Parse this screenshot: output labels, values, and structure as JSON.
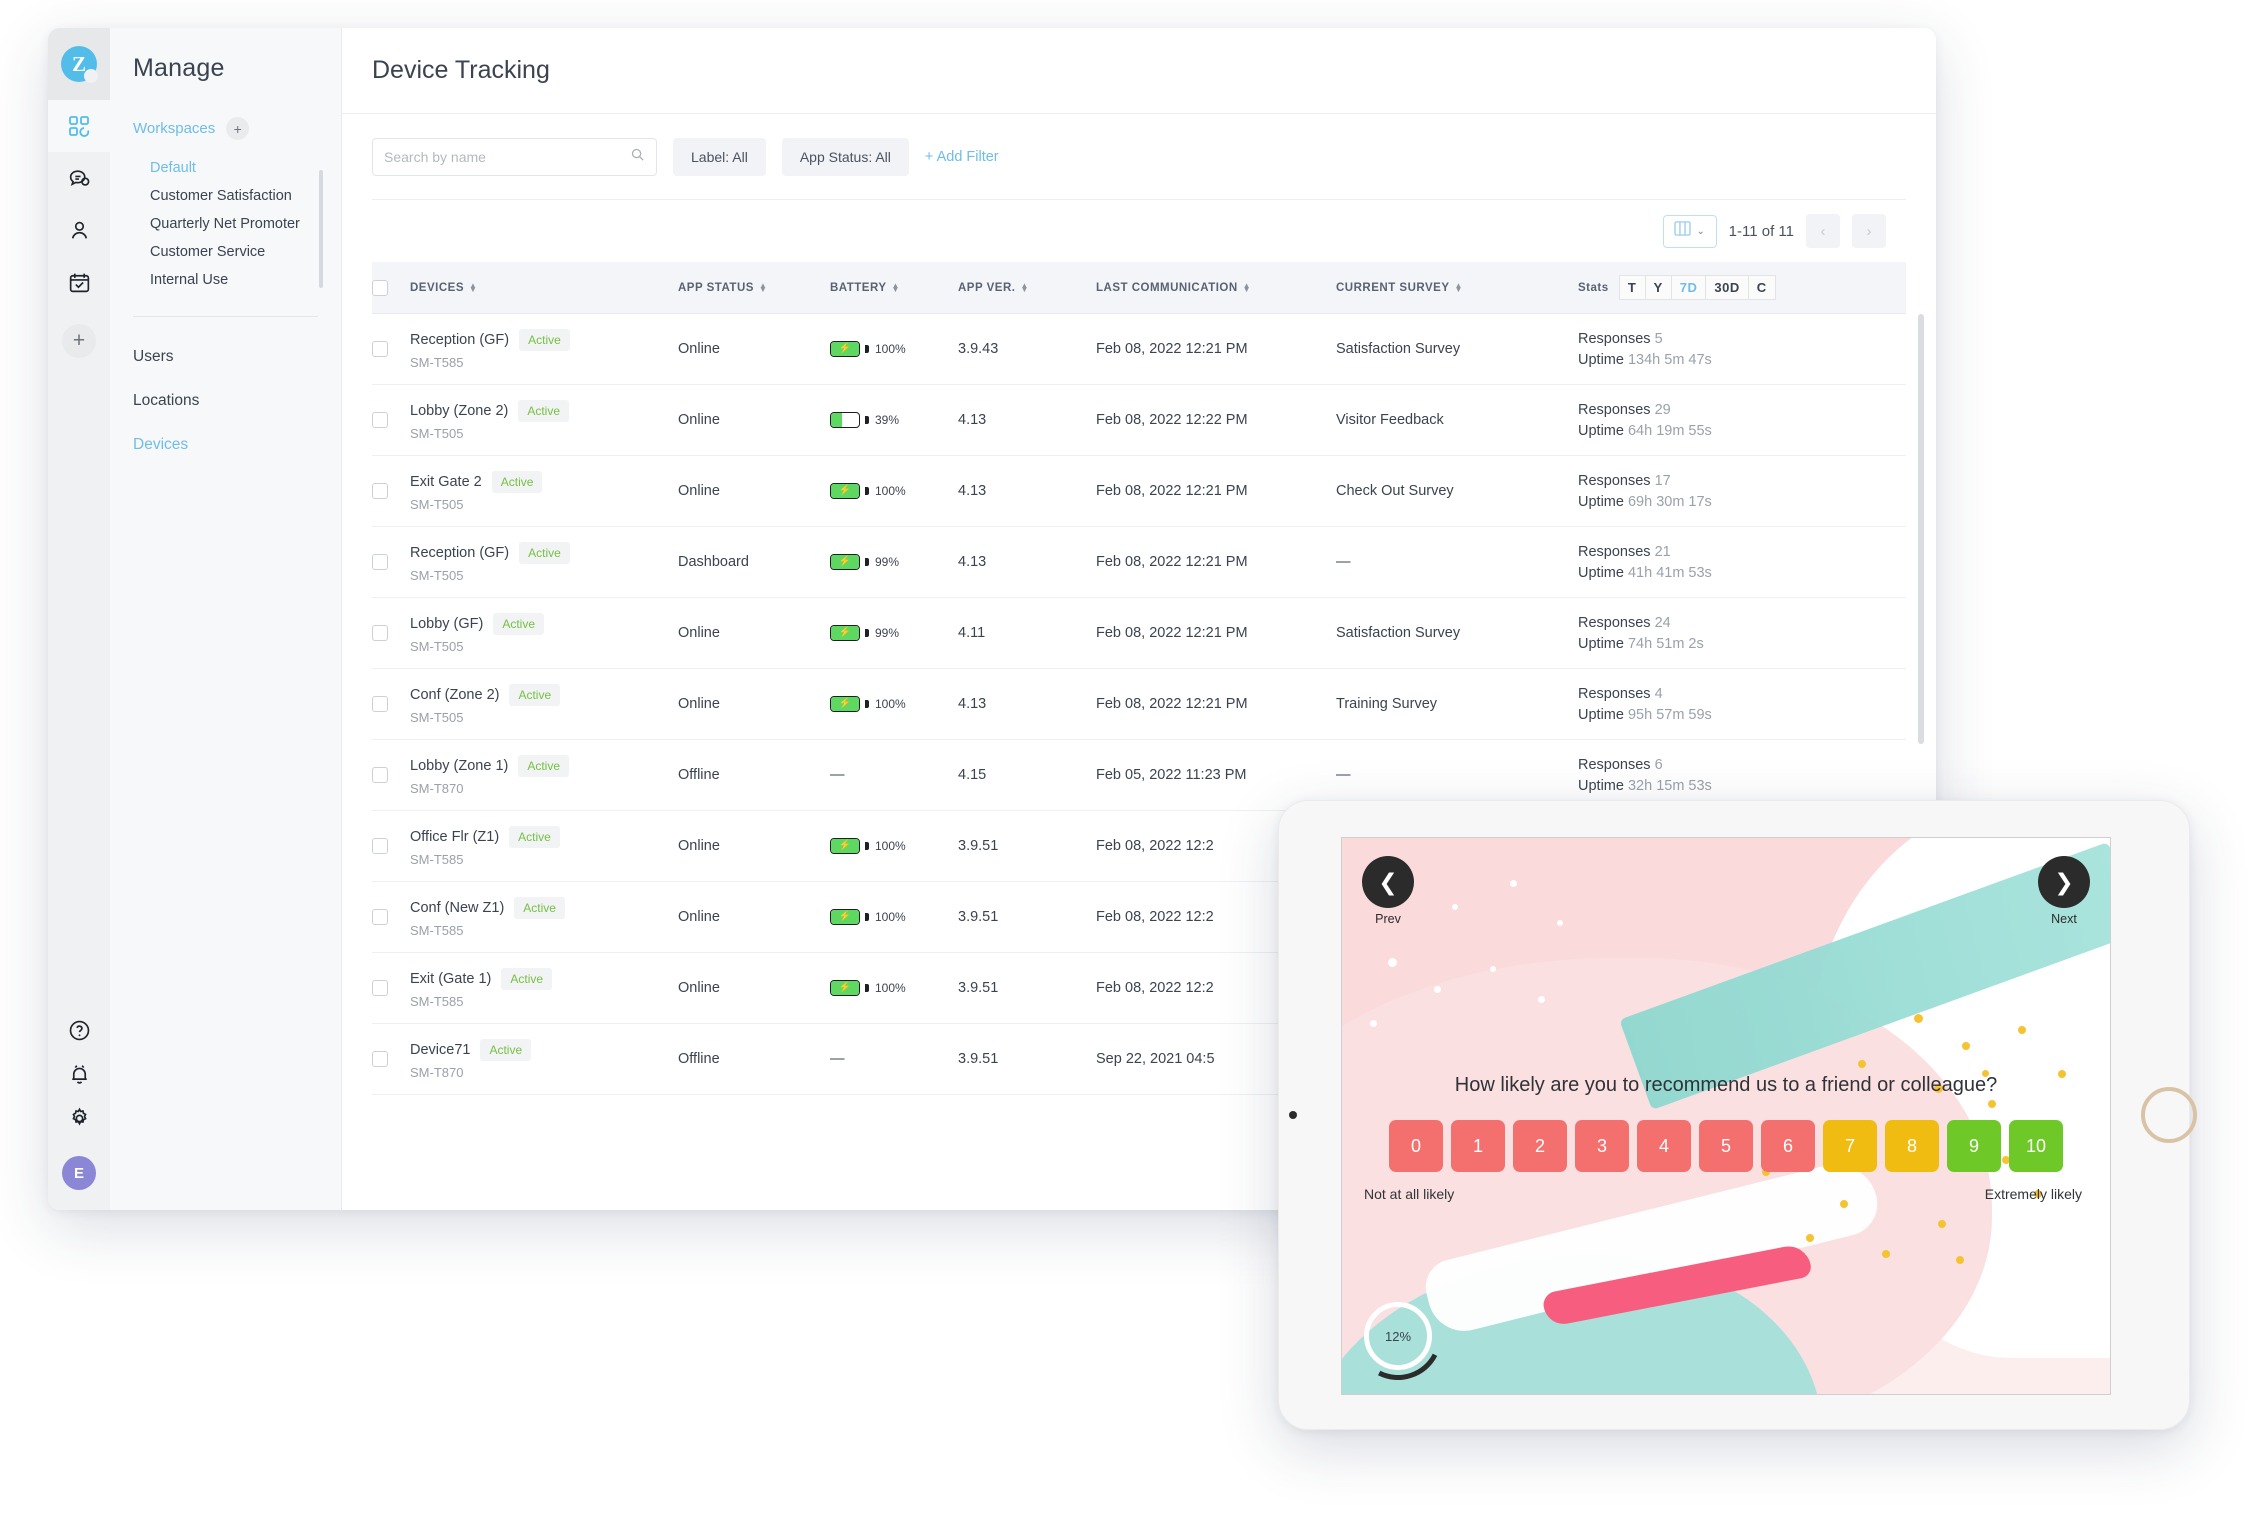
{
  "app": {
    "logo_letter": "Z",
    "nav_title": "Manage",
    "rail_icons": [
      {
        "name": "workspace-grid-icon",
        "glyph": "grid"
      },
      {
        "name": "feedback-chat-icon",
        "glyph": "chat"
      },
      {
        "name": "contacts-person-icon",
        "glyph": "person"
      },
      {
        "name": "tasks-calendar-icon",
        "glyph": "calendar"
      }
    ],
    "rail_add_label": "+",
    "rail_bottom_icons": [
      {
        "name": "help-icon",
        "glyph": "question"
      },
      {
        "name": "notifications-bell-icon",
        "glyph": "bell"
      },
      {
        "name": "settings-gear-icon",
        "glyph": "gear"
      }
    ],
    "avatar_letter": "E"
  },
  "sidebar": {
    "workspaces_label": "Workspaces",
    "workspaces_add": "+",
    "workspaces": [
      {
        "label": "Default",
        "selected": true
      },
      {
        "label": "Customer Satisfaction",
        "selected": false
      },
      {
        "label": "Quarterly Net Promoter",
        "selected": false
      },
      {
        "label": "Customer Service",
        "selected": false
      },
      {
        "label": "Internal Use",
        "selected": false
      }
    ],
    "links": [
      {
        "label": "Users",
        "selected": false
      },
      {
        "label": "Locations",
        "selected": false
      },
      {
        "label": "Devices",
        "selected": true
      }
    ]
  },
  "page": {
    "title": "Device Tracking"
  },
  "filters": {
    "search_placeholder": "Search by name",
    "search_value": "",
    "search_icon": "search-icon",
    "chips": [
      {
        "label": "Label: All"
      },
      {
        "label": "App Status: All"
      }
    ],
    "add_filter": "+ Add Filter"
  },
  "toolbar": {
    "columns_icon": "columns-icon",
    "columns_chevron": "⌄",
    "range": "1-11 of 11",
    "prev_glyph": "‹",
    "next_glyph": "›"
  },
  "table": {
    "columns": [
      {
        "label": "DEVICES",
        "sortable": true
      },
      {
        "label": "APP STATUS",
        "sortable": true
      },
      {
        "label": "BATTERY",
        "sortable": true
      },
      {
        "label": "APP VER.",
        "sortable": true
      },
      {
        "label": "LAST COMMUNICATION",
        "sortable": true
      },
      {
        "label": "CURRENT SURVEY",
        "sortable": true
      }
    ],
    "stats_label": "Stats",
    "stats_segments": [
      {
        "label": "T",
        "active": false
      },
      {
        "label": "Y",
        "active": false
      },
      {
        "label": "7D",
        "active": true
      },
      {
        "label": "30D",
        "active": false
      },
      {
        "label": "C",
        "active": false
      }
    ],
    "responses_label": "Responses",
    "uptime_label": "Uptime",
    "rows": [
      {
        "name": "Reception (GF)",
        "badge": "Active",
        "model": "SM-T585",
        "app_status": "Online",
        "battery": "100%",
        "battery_pct": 100,
        "charging": true,
        "app_ver": "3.9.43",
        "last_comm": "Feb 08, 2022 12:21 PM",
        "current_survey": "Satisfaction Survey",
        "responses": "5",
        "uptime": "134h 5m 47s"
      },
      {
        "name": "Lobby (Zone 2)",
        "badge": "Active",
        "model": "SM-T505",
        "app_status": "Online",
        "battery": "39%",
        "battery_pct": 39,
        "charging": false,
        "app_ver": "4.13",
        "last_comm": "Feb 08, 2022 12:22 PM",
        "current_survey": "Visitor Feedback",
        "responses": "29",
        "uptime": "64h 19m 55s"
      },
      {
        "name": "Exit Gate 2",
        "badge": "Active",
        "model": "SM-T505",
        "app_status": "Online",
        "battery": "100%",
        "battery_pct": 100,
        "charging": true,
        "app_ver": "4.13",
        "last_comm": "Feb 08, 2022 12:21 PM",
        "current_survey": "Check Out Survey",
        "responses": "17",
        "uptime": "69h 30m 17s"
      },
      {
        "name": "Reception (GF)",
        "badge": "Active",
        "model": "SM-T505",
        "app_status": "Dashboard",
        "battery": "99%",
        "battery_pct": 99,
        "charging": true,
        "app_ver": "4.13",
        "last_comm": "Feb 08, 2022 12:21 PM",
        "current_survey": "—",
        "responses": "21",
        "uptime": "41h 41m 53s"
      },
      {
        "name": "Lobby (GF)",
        "badge": "Active",
        "model": "SM-T505",
        "app_status": "Online",
        "battery": "99%",
        "battery_pct": 99,
        "charging": true,
        "app_ver": "4.11",
        "last_comm": "Feb 08, 2022 12:21 PM",
        "current_survey": "Satisfaction Survey",
        "responses": "24",
        "uptime": "74h 51m 2s"
      },
      {
        "name": "Conf (Zone 2)",
        "badge": "Active",
        "model": "SM-T505",
        "app_status": "Online",
        "battery": "100%",
        "battery_pct": 100,
        "charging": true,
        "app_ver": "4.13",
        "last_comm": "Feb 08, 2022 12:21 PM",
        "current_survey": "Training Survey",
        "responses": "4",
        "uptime": "95h 57m 59s"
      },
      {
        "name": "Lobby (Zone 1)",
        "badge": "Active",
        "model": "SM-T870",
        "app_status": "Offline",
        "battery": "—",
        "battery_pct": null,
        "charging": false,
        "app_ver": "4.15",
        "last_comm": "Feb 05, 2022 11:23 PM",
        "current_survey": "—",
        "responses": "6",
        "uptime": "32h 15m 53s"
      },
      {
        "name": "Office Flr (Z1)",
        "badge": "Active",
        "model": "SM-T585",
        "app_status": "Online",
        "battery": "100%",
        "battery_pct": 100,
        "charging": true,
        "app_ver": "3.9.51",
        "last_comm": "Feb 08, 2022 12:2",
        "current_survey": "",
        "responses": "",
        "uptime": ""
      },
      {
        "name": "Conf (New Z1)",
        "badge": "Active",
        "model": "SM-T585",
        "app_status": "Online",
        "battery": "100%",
        "battery_pct": 100,
        "charging": true,
        "app_ver": "3.9.51",
        "last_comm": "Feb 08, 2022 12:2",
        "current_survey": "",
        "responses": "",
        "uptime": ""
      },
      {
        "name": "Exit (Gate 1)",
        "badge": "Active",
        "model": "SM-T585",
        "app_status": "Online",
        "battery": "100%",
        "battery_pct": 100,
        "charging": true,
        "app_ver": "3.9.51",
        "last_comm": "Feb 08, 2022 12:2",
        "current_survey": "",
        "responses": "",
        "uptime": ""
      },
      {
        "name": "Device71",
        "badge": "Active",
        "model": "SM-T870",
        "app_status": "Offline",
        "battery": "—",
        "battery_pct": null,
        "charging": false,
        "app_ver": "3.9.51",
        "last_comm": "Sep 22, 2021 04:5",
        "current_survey": "",
        "responses": "",
        "uptime": ""
      }
    ]
  },
  "tablet": {
    "prev_label": "Prev",
    "next_label": "Next",
    "prev_glyph": "❮",
    "next_glyph": "❯",
    "question": "How likely are you to recommend us to a friend or colleague?",
    "anchor_left": "Not at all likely",
    "anchor_right": "Extremely likely",
    "progress": "12%",
    "scale": [
      {
        "value": "0",
        "color": "#f4706e"
      },
      {
        "value": "1",
        "color": "#f4706e"
      },
      {
        "value": "2",
        "color": "#f4706e"
      },
      {
        "value": "3",
        "color": "#f4706e"
      },
      {
        "value": "4",
        "color": "#f4706e"
      },
      {
        "value": "5",
        "color": "#f4706e"
      },
      {
        "value": "6",
        "color": "#f4706e"
      },
      {
        "value": "7",
        "color": "#f0bc12"
      },
      {
        "value": "8",
        "color": "#f0bc12"
      },
      {
        "value": "9",
        "color": "#6ec928"
      },
      {
        "value": "10",
        "color": "#6ec928"
      }
    ]
  },
  "colors": {
    "accent": "#6fbde8",
    "active_green": "#76c043",
    "battery_green": "#5fd861",
    "avatar": "#8b86d6"
  }
}
